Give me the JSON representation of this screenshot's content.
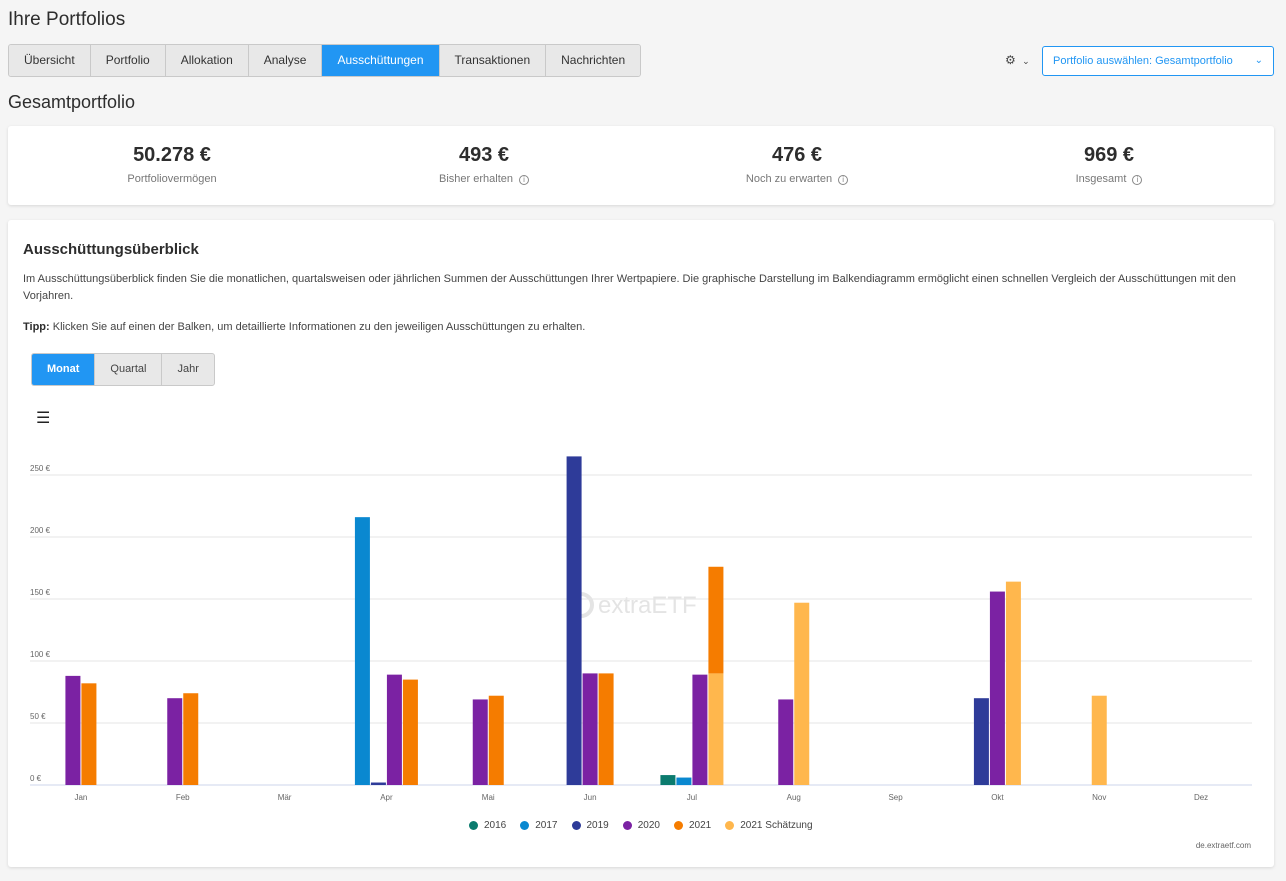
{
  "page_title": "Ihre Portfolios",
  "tabs": [
    {
      "label": "Übersicht"
    },
    {
      "label": "Portfolio"
    },
    {
      "label": "Allokation"
    },
    {
      "label": "Analyse"
    },
    {
      "label": "Ausschüttungen",
      "active": true
    },
    {
      "label": "Transaktionen"
    },
    {
      "label": "Nachrichten"
    }
  ],
  "settings_icon": "gear-icon",
  "portfolio_select": {
    "label": "Portfolio auswählen: Gesamtportfolio"
  },
  "subtitle": "Gesamtportfolio",
  "stats": [
    {
      "value": "50.278 €",
      "label": "Portfoliovermögen",
      "info": false
    },
    {
      "value": "493 €",
      "label": "Bisher erhalten",
      "info": true
    },
    {
      "value": "476 €",
      "label": "Noch zu erwarten",
      "info": true
    },
    {
      "value": "969 €",
      "label": "Insgesamt",
      "info": true
    }
  ],
  "overview": {
    "title": "Ausschüttungsüberblick",
    "description": "Im Ausschüttungsüberblick finden Sie die monatlichen, quartalsweisen oder jährlichen Summen der Ausschüttungen Ihrer Wertpapiere. Die graphische Darstellung im Balkendiagramm ermöglicht einen schnellen Vergleich der Ausschüttungen mit den Vorjahren.",
    "tip_label": "Tipp:",
    "tip_text": " Klicken Sie auf einen der Balken, um detaillierte Informationen zu den jeweiligen Ausschüttungen zu erhalten.",
    "periods": [
      {
        "label": "Monat",
        "active": true
      },
      {
        "label": "Quartal"
      },
      {
        "label": "Jahr"
      }
    ],
    "menu_icon": "☰",
    "watermark": "extraETF",
    "credit": "de.extraetf.com"
  },
  "chart_data": {
    "type": "bar",
    "categories": [
      "Jan",
      "Feb",
      "Mär",
      "Apr",
      "Mai",
      "Jun",
      "Jul",
      "Aug",
      "Sep",
      "Okt",
      "Nov",
      "Dez"
    ],
    "ylim": [
      0,
      250
    ],
    "yticks": [
      0,
      50,
      100,
      150,
      200,
      250
    ],
    "ytick_labels": [
      "0 €",
      "50 €",
      "100 €",
      "150 €",
      "200 €",
      "250 €"
    ],
    "grid": true,
    "legend_position": "bottom",
    "series": [
      {
        "name": "2016",
        "color": "#0b7b6e",
        "values": [
          0,
          0,
          0,
          0,
          0,
          0,
          8,
          0,
          0,
          0,
          0,
          0
        ]
      },
      {
        "name": "2017",
        "color": "#0a88d0",
        "values": [
          0,
          0,
          0,
          216,
          0,
          0,
          6,
          0,
          0,
          0,
          0,
          0
        ]
      },
      {
        "name": "2019",
        "color": "#2e3b99",
        "values": [
          0,
          0,
          0,
          2,
          0,
          265,
          0,
          0,
          0,
          70,
          0,
          0
        ]
      },
      {
        "name": "2020",
        "color": "#7b22a3",
        "values": [
          88,
          70,
          0,
          89,
          69,
          90,
          89,
          69,
          0,
          156,
          0,
          0
        ]
      },
      {
        "name": "2021",
        "color": "#f57c00",
        "values": [
          82,
          74,
          0,
          85,
          72,
          90,
          86,
          0,
          0,
          0,
          0,
          0
        ]
      },
      {
        "name": "2021 Schätzung",
        "color": "#ffb74d",
        "values": [
          0,
          0,
          0,
          0,
          0,
          0,
          90,
          147,
          0,
          164,
          72,
          0
        ]
      }
    ]
  }
}
